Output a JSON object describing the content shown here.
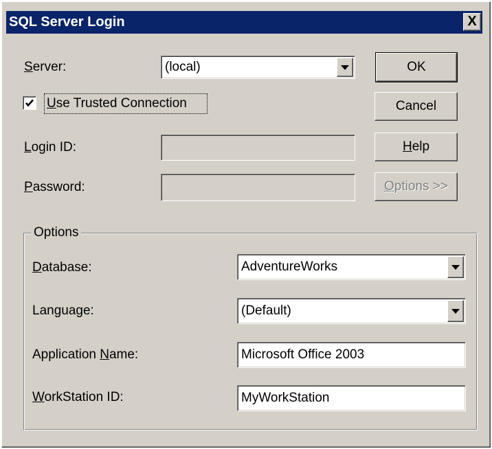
{
  "dialog": {
    "title": "SQL Server Login",
    "close_glyph": "X"
  },
  "server": {
    "label_accel": "S",
    "label_rest": "erver:",
    "value": "(local)"
  },
  "trusted": {
    "accel": "U",
    "rest": "se Trusted Connection",
    "checked": true
  },
  "login": {
    "accel": "L",
    "rest": "ogin ID:",
    "value": ""
  },
  "password": {
    "accel": "P",
    "rest": "assword:",
    "value": ""
  },
  "buttons": {
    "ok": "OK",
    "cancel": "Cancel",
    "help_accel": "H",
    "help_rest": "elp",
    "options_accel": "O",
    "options_rest": "ptions >>"
  },
  "options_group": {
    "legend": "Options",
    "database": {
      "accel": "D",
      "rest": "atabase:",
      "value": "AdventureWorks"
    },
    "language": {
      "label": "Language:",
      "value": "(Default)"
    },
    "app_name": {
      "before": "Application ",
      "accel": "N",
      "rest": "ame:",
      "value": "Microsoft Office 2003"
    },
    "workstation": {
      "accel": "W",
      "rest": "orkStation ID:",
      "value": "MyWorkStation"
    }
  },
  "colors": {
    "dialog_bg": "#d4d0c8",
    "title_bar": "#0a246a",
    "disabled_text": "#808080"
  }
}
